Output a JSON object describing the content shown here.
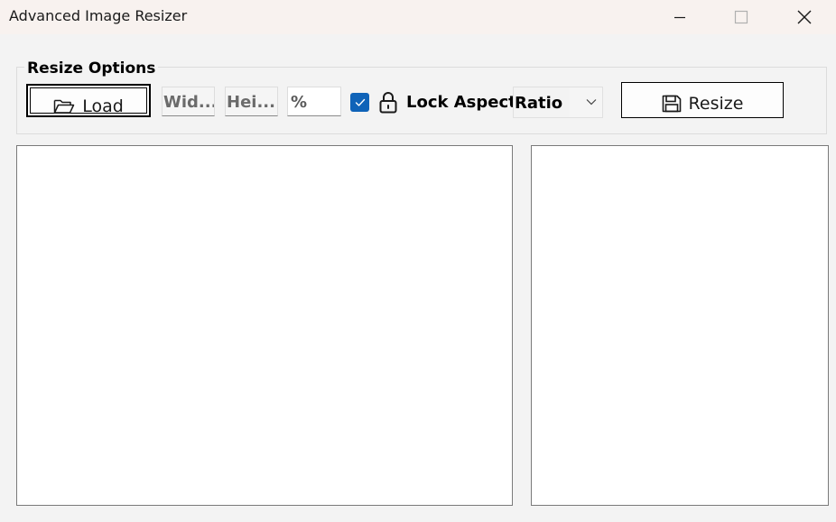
{
  "window": {
    "title": "Advanced Image Resizer",
    "controls": {
      "minimize_icon": "minimize-icon",
      "maximize_icon": "maximize-icon",
      "close_icon": "close-icon"
    }
  },
  "resize_options": {
    "group_label": "Resize Options",
    "load_button": {
      "label": "Load",
      "icon": "folder-open-icon"
    },
    "width_field": {
      "value": "Wid..."
    },
    "height_field": {
      "value": "Hei..."
    },
    "percent_field": {
      "value": "%"
    },
    "lock_aspect": {
      "checked": true,
      "icon": "lock-icon",
      "label": "Lock Aspect"
    },
    "mode_dropdown": {
      "selected": "Ratio",
      "icon": "chevron-down-icon"
    },
    "resize_button": {
      "label": "Resize",
      "icon": "floppy-disk-icon"
    }
  },
  "colors": {
    "title_bar": "#f8f2ef",
    "window_bg": "#f3f3f3",
    "checkbox_accent": "#0f63b8",
    "panel_bg": "#ffffff"
  }
}
